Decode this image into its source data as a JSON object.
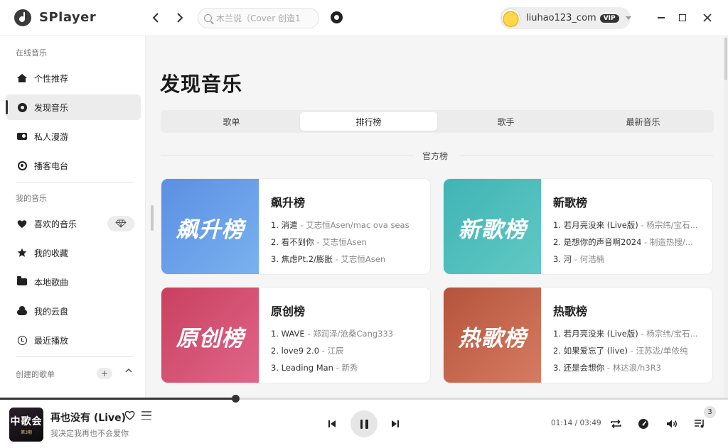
{
  "app": {
    "title": "SPlayer"
  },
  "titlebar": {
    "back_icon": "chevron-left-icon",
    "forward_icon": "chevron-right-icon",
    "search_placeholder": "木兰说（Cover 创造1",
    "github_icon": "github-icon",
    "user": {
      "name": "liuhao123_com",
      "badge": "VIP"
    }
  },
  "sidebar": {
    "section_online": "在线音乐",
    "online_items": [
      {
        "label": "个性推荐",
        "icon": "home-icon",
        "active": false
      },
      {
        "label": "发现音乐",
        "icon": "disc-icon",
        "active": true
      },
      {
        "label": "私人漫游",
        "icon": "radio-icon",
        "active": false
      },
      {
        "label": "播客电台",
        "icon": "podcast-icon",
        "active": false
      }
    ],
    "section_mine": "我的音乐",
    "mine_items": [
      {
        "label": "喜欢的音乐",
        "icon": "heart-icon"
      },
      {
        "label": "我的收藏",
        "icon": "star-icon"
      },
      {
        "label": "本地歌曲",
        "icon": "folder-icon"
      },
      {
        "label": "我的云盘",
        "icon": "cloud-icon"
      },
      {
        "label": "最近播放",
        "icon": "history-icon"
      }
    ],
    "section_created": "创建的歌单",
    "heart_mode_icon": "diamond-icon"
  },
  "main": {
    "title": "发现音乐",
    "tabs": [
      {
        "label": "歌单",
        "active": false
      },
      {
        "label": "排行榜",
        "active": true
      },
      {
        "label": "歌手",
        "active": false
      },
      {
        "label": "最新音乐",
        "active": false
      }
    ],
    "section_label": "官方榜",
    "charts": [
      {
        "name": "飙升榜",
        "cover_text": "飙升榜",
        "cover_colors": [
          "#5b8fe3",
          "#7ab2ef"
        ],
        "tracks": [
          {
            "rank": "1.",
            "song": "消遣",
            "artist": "艾志恒Asen/mac ova seas"
          },
          {
            "rank": "2.",
            "song": "看不到你",
            "artist": "艾志恒Asen"
          },
          {
            "rank": "3.",
            "song": "焦虑Pt.2/膨胀",
            "artist": "艾志恒Asen"
          }
        ]
      },
      {
        "name": "新歌榜",
        "cover_text": "新歌榜",
        "cover_colors": [
          "#3fb4b4",
          "#62c9c4"
        ],
        "tracks": [
          {
            "rank": "1.",
            "song": "若月亮没来 (Live版)",
            "artist": "杨宗纬/宝石..."
          },
          {
            "rank": "2.",
            "song": "是想你的声音啊2024",
            "artist": "制造热搜/..."
          },
          {
            "rank": "3.",
            "song": "河",
            "artist": "何浩楠"
          }
        ]
      },
      {
        "name": "原创榜",
        "cover_text": "原创榜",
        "cover_colors": [
          "#c9405f",
          "#e0668a"
        ],
        "tracks": [
          {
            "rank": "1.",
            "song": "WAVE",
            "artist": "郑润泽/沧桑Cang333"
          },
          {
            "rank": "2.",
            "song": "love9 2.0",
            "artist": "江辰"
          },
          {
            "rank": "3.",
            "song": "Leading Man",
            "artist": "新秀"
          }
        ]
      },
      {
        "name": "热歌榜",
        "cover_text": "热歌榜",
        "cover_colors": [
          "#b5533c",
          "#d67c62"
        ],
        "tracks": [
          {
            "rank": "1.",
            "song": "若月亮没来 (Live版)",
            "artist": "杨宗纬/宝石..."
          },
          {
            "rank": "2.",
            "song": "如果爱忘了 (live)",
            "artist": "汪苏泷/单依纯"
          },
          {
            "rank": "3.",
            "song": "还是会想你",
            "artist": "林达浪/h3R3"
          }
        ]
      }
    ]
  },
  "player": {
    "song_title": "再也没有 (Live)",
    "song_artist": "我决定我再也不会爱你",
    "album_text": "中歌会",
    "album_sub": "第3期",
    "time_text": "01:14 / 03:49",
    "progress": 0.323,
    "queue_count": "3",
    "icons": [
      "heart-icon",
      "playlist-icon",
      "previous-icon",
      "pause-icon",
      "next-icon",
      "repeat-icon",
      "speed-icon",
      "volume-icon",
      "queue-icon"
    ]
  }
}
